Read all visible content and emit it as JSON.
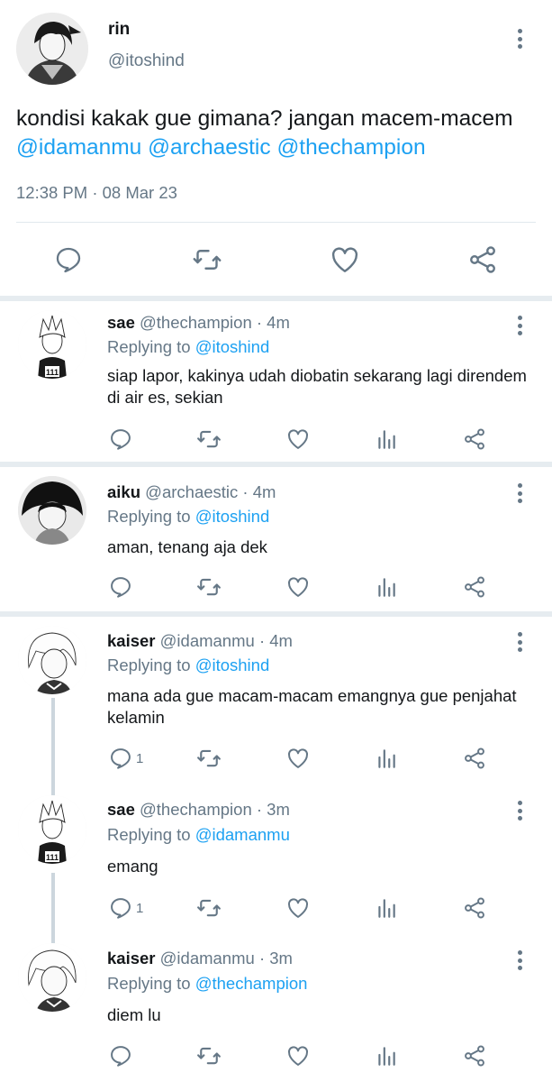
{
  "main_tweet": {
    "name": "rin",
    "handle": "@itoshind",
    "text_prefix": "kondisi kakak gue gimana? jangan macem-macem",
    "mentions": [
      "@idamanmu",
      "@archaestic",
      "@thechampion"
    ],
    "timestamp": "12:38 PM · 08 Mar 23",
    "actions": [
      "reply-icon",
      "retweet-icon",
      "like-icon",
      "share-icon"
    ]
  },
  "replies": [
    {
      "name": "sae",
      "handle": "@thechampion",
      "time": "· 4m",
      "replying_label": "Replying to",
      "replying_to": "@itoshind",
      "text": "siap lapor, kakinya udah diobatin sekarang lagi direndem di air es, sekian",
      "reply_count": ""
    },
    {
      "name": "aiku",
      "handle": "@archaestic",
      "time": "· 4m",
      "replying_label": "Replying to",
      "replying_to": "@itoshind",
      "text": "aman, tenang aja dek",
      "reply_count": ""
    },
    {
      "name": "kaiser",
      "handle": "@idamanmu",
      "time": "· 4m",
      "replying_label": "Replying to",
      "replying_to": "@itoshind",
      "text": "mana ada gue macam-macam emangnya gue penjahat kelamin",
      "reply_count": "1"
    },
    {
      "name": "sae",
      "handle": "@thechampion",
      "time": "· 3m",
      "replying_label": "Replying to",
      "replying_to": "@idamanmu",
      "text": "emang",
      "reply_count": "1"
    },
    {
      "name": "kaiser",
      "handle": "@idamanmu",
      "time": "· 3m",
      "replying_label": "Replying to",
      "replying_to": "@thechampion",
      "text": "diem lu",
      "reply_count": ""
    }
  ],
  "reply_actions": [
    "reply-icon",
    "retweet-icon",
    "like-icon",
    "analytics-icon",
    "share-icon"
  ],
  "colors": {
    "link": "#1da1f2",
    "secondary_text": "#657786",
    "divider": "#e6ecf0",
    "thread_line": "#ccd6dd"
  }
}
